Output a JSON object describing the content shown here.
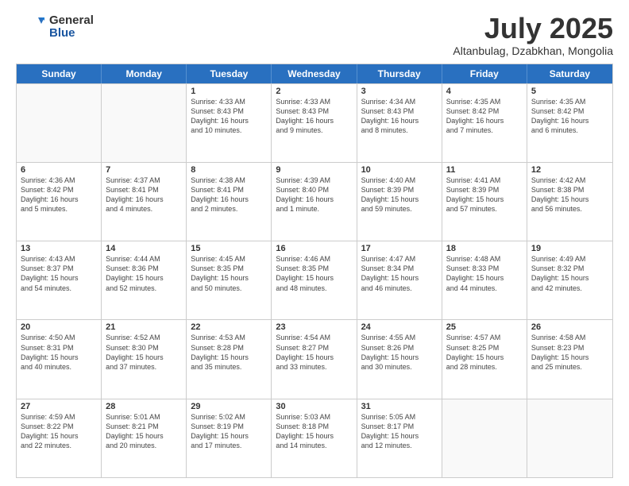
{
  "logo": {
    "general": "General",
    "blue": "Blue"
  },
  "title": "July 2025",
  "location": "Altanbulag, Dzabkhan, Mongolia",
  "header_days": [
    "Sunday",
    "Monday",
    "Tuesday",
    "Wednesday",
    "Thursday",
    "Friday",
    "Saturday"
  ],
  "weeks": [
    [
      {
        "day": "",
        "text": ""
      },
      {
        "day": "",
        "text": ""
      },
      {
        "day": "1",
        "text": "Sunrise: 4:33 AM\nSunset: 8:43 PM\nDaylight: 16 hours\nand 10 minutes."
      },
      {
        "day": "2",
        "text": "Sunrise: 4:33 AM\nSunset: 8:43 PM\nDaylight: 16 hours\nand 9 minutes."
      },
      {
        "day": "3",
        "text": "Sunrise: 4:34 AM\nSunset: 8:43 PM\nDaylight: 16 hours\nand 8 minutes."
      },
      {
        "day": "4",
        "text": "Sunrise: 4:35 AM\nSunset: 8:42 PM\nDaylight: 16 hours\nand 7 minutes."
      },
      {
        "day": "5",
        "text": "Sunrise: 4:35 AM\nSunset: 8:42 PM\nDaylight: 16 hours\nand 6 minutes."
      }
    ],
    [
      {
        "day": "6",
        "text": "Sunrise: 4:36 AM\nSunset: 8:42 PM\nDaylight: 16 hours\nand 5 minutes."
      },
      {
        "day": "7",
        "text": "Sunrise: 4:37 AM\nSunset: 8:41 PM\nDaylight: 16 hours\nand 4 minutes."
      },
      {
        "day": "8",
        "text": "Sunrise: 4:38 AM\nSunset: 8:41 PM\nDaylight: 16 hours\nand 2 minutes."
      },
      {
        "day": "9",
        "text": "Sunrise: 4:39 AM\nSunset: 8:40 PM\nDaylight: 16 hours\nand 1 minute."
      },
      {
        "day": "10",
        "text": "Sunrise: 4:40 AM\nSunset: 8:39 PM\nDaylight: 15 hours\nand 59 minutes."
      },
      {
        "day": "11",
        "text": "Sunrise: 4:41 AM\nSunset: 8:39 PM\nDaylight: 15 hours\nand 57 minutes."
      },
      {
        "day": "12",
        "text": "Sunrise: 4:42 AM\nSunset: 8:38 PM\nDaylight: 15 hours\nand 56 minutes."
      }
    ],
    [
      {
        "day": "13",
        "text": "Sunrise: 4:43 AM\nSunset: 8:37 PM\nDaylight: 15 hours\nand 54 minutes."
      },
      {
        "day": "14",
        "text": "Sunrise: 4:44 AM\nSunset: 8:36 PM\nDaylight: 15 hours\nand 52 minutes."
      },
      {
        "day": "15",
        "text": "Sunrise: 4:45 AM\nSunset: 8:35 PM\nDaylight: 15 hours\nand 50 minutes."
      },
      {
        "day": "16",
        "text": "Sunrise: 4:46 AM\nSunset: 8:35 PM\nDaylight: 15 hours\nand 48 minutes."
      },
      {
        "day": "17",
        "text": "Sunrise: 4:47 AM\nSunset: 8:34 PM\nDaylight: 15 hours\nand 46 minutes."
      },
      {
        "day": "18",
        "text": "Sunrise: 4:48 AM\nSunset: 8:33 PM\nDaylight: 15 hours\nand 44 minutes."
      },
      {
        "day": "19",
        "text": "Sunrise: 4:49 AM\nSunset: 8:32 PM\nDaylight: 15 hours\nand 42 minutes."
      }
    ],
    [
      {
        "day": "20",
        "text": "Sunrise: 4:50 AM\nSunset: 8:31 PM\nDaylight: 15 hours\nand 40 minutes."
      },
      {
        "day": "21",
        "text": "Sunrise: 4:52 AM\nSunset: 8:30 PM\nDaylight: 15 hours\nand 37 minutes."
      },
      {
        "day": "22",
        "text": "Sunrise: 4:53 AM\nSunset: 8:28 PM\nDaylight: 15 hours\nand 35 minutes."
      },
      {
        "day": "23",
        "text": "Sunrise: 4:54 AM\nSunset: 8:27 PM\nDaylight: 15 hours\nand 33 minutes."
      },
      {
        "day": "24",
        "text": "Sunrise: 4:55 AM\nSunset: 8:26 PM\nDaylight: 15 hours\nand 30 minutes."
      },
      {
        "day": "25",
        "text": "Sunrise: 4:57 AM\nSunset: 8:25 PM\nDaylight: 15 hours\nand 28 minutes."
      },
      {
        "day": "26",
        "text": "Sunrise: 4:58 AM\nSunset: 8:23 PM\nDaylight: 15 hours\nand 25 minutes."
      }
    ],
    [
      {
        "day": "27",
        "text": "Sunrise: 4:59 AM\nSunset: 8:22 PM\nDaylight: 15 hours\nand 22 minutes."
      },
      {
        "day": "28",
        "text": "Sunrise: 5:01 AM\nSunset: 8:21 PM\nDaylight: 15 hours\nand 20 minutes."
      },
      {
        "day": "29",
        "text": "Sunrise: 5:02 AM\nSunset: 8:19 PM\nDaylight: 15 hours\nand 17 minutes."
      },
      {
        "day": "30",
        "text": "Sunrise: 5:03 AM\nSunset: 8:18 PM\nDaylight: 15 hours\nand 14 minutes."
      },
      {
        "day": "31",
        "text": "Sunrise: 5:05 AM\nSunset: 8:17 PM\nDaylight: 15 hours\nand 12 minutes."
      },
      {
        "day": "",
        "text": ""
      },
      {
        "day": "",
        "text": ""
      }
    ]
  ]
}
